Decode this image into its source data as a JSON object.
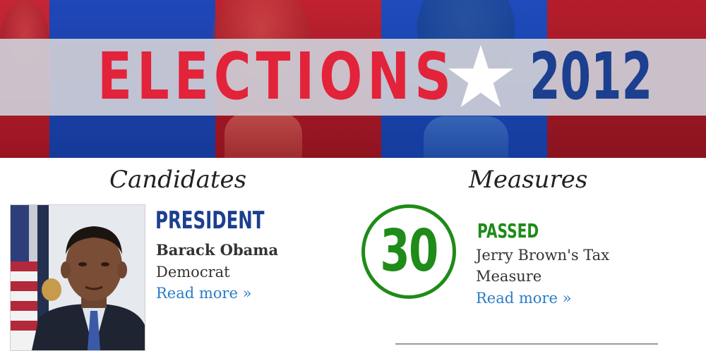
{
  "banner": {
    "word": "ELECTIONS",
    "year": "2012",
    "star_icon": "star-icon",
    "colors": {
      "red": "#e2233a",
      "blue": "#1c3f8f",
      "band": "#cecdd6"
    }
  },
  "candidates": {
    "heading": "Candidates",
    "race": "PRESIDENT",
    "name": "Barack Obama",
    "party": "Democrat",
    "read_more": "Read more »"
  },
  "measures": {
    "heading": "Measures",
    "number": "30",
    "status": "PASSED",
    "name": "Jerry Brown's Tax Measure",
    "read_more": "Read more »",
    "status_color": "#1f8b18"
  }
}
